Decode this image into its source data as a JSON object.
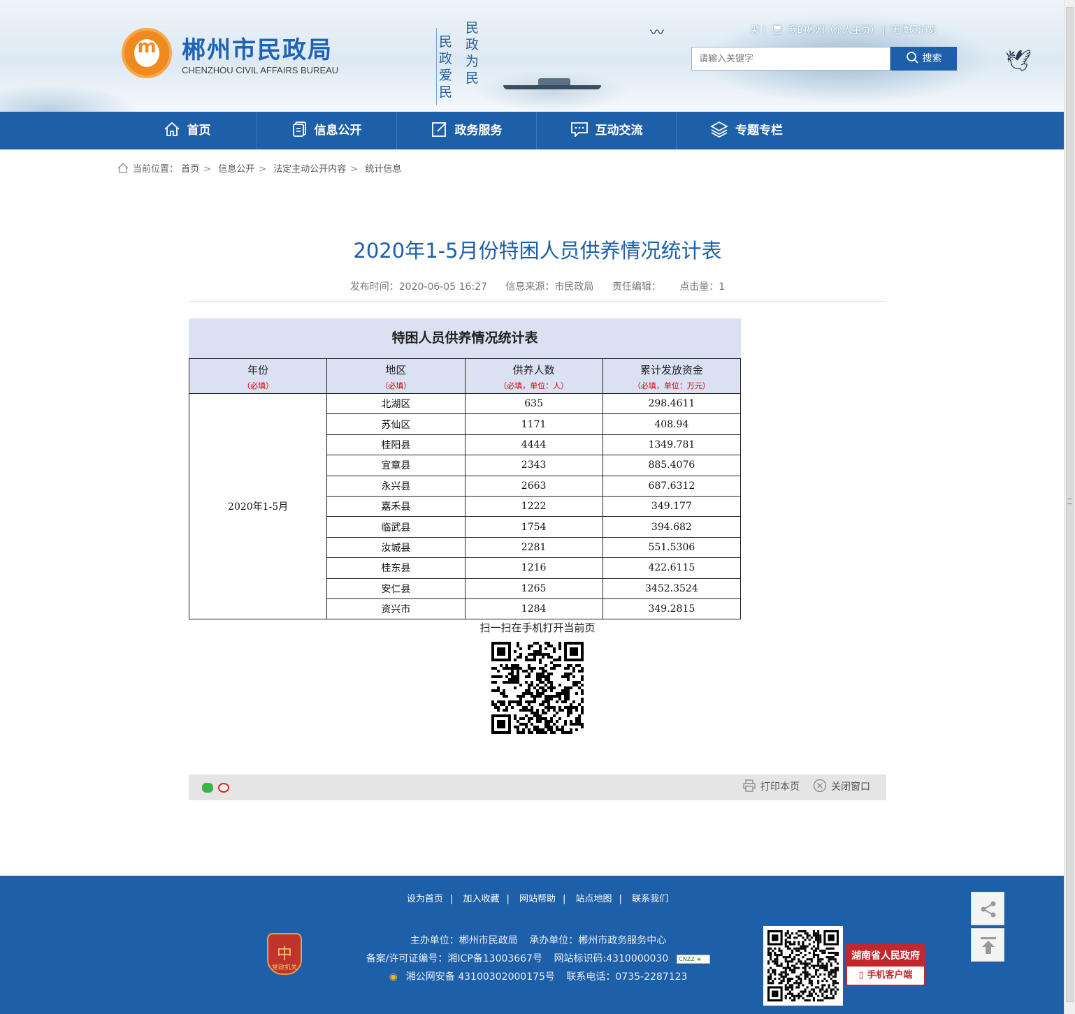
{
  "header": {
    "site_title": "郴州市民政局",
    "site_subtitle": "CHENZHOU CIVIL AFFAIRS BUREAU",
    "slogan_right": "民政为民",
    "slogan_left": "民政爱民",
    "top_links": [
      "繁",
      "我的郴州（个人主页）",
      "无障碍浏览"
    ],
    "search_placeholder": "请输入关键字",
    "search_label": "搜索"
  },
  "nav": [
    {
      "label": "首页",
      "icon": "home-icon"
    },
    {
      "label": "信息公开",
      "icon": "document-icon"
    },
    {
      "label": "政务服务",
      "icon": "edit-icon"
    },
    {
      "label": "互动交流",
      "icon": "chat-icon"
    },
    {
      "label": "专题专栏",
      "icon": "layers-icon"
    }
  ],
  "breadcrumb": {
    "prefix": "当前位置：",
    "items": [
      "首页",
      "信息公开",
      "法定主动公开内容",
      "统计信息"
    ]
  },
  "article": {
    "title": "2020年1-5月份特困人员供养情况统计表",
    "publish_time": "发布时间：2020-06-05 16:27",
    "source": "信息来源：市民政局",
    "editor": "责任编辑：",
    "clicks": "点击量：1"
  },
  "table": {
    "caption": "特困人员供养情况统计表",
    "columns": [
      {
        "label": "年份",
        "note": "（必填）"
      },
      {
        "label": "地区",
        "note": "（必填）"
      },
      {
        "label": "供养人数",
        "note": "（必填，单位：人）"
      },
      {
        "label": "累计发放资金",
        "note": "（必填，单位：万元）"
      }
    ],
    "period": "2020年1-5月",
    "rows": [
      {
        "region": "北湖区",
        "people": "635",
        "funds": "298.4611"
      },
      {
        "region": "苏仙区",
        "people": "1171",
        "funds": "408.94"
      },
      {
        "region": "桂阳县",
        "people": "4444",
        "funds": "1349.781"
      },
      {
        "region": "宜章县",
        "people": "2343",
        "funds": "885.4076"
      },
      {
        "region": "永兴县",
        "people": "2663",
        "funds": "687.6312"
      },
      {
        "region": "嘉禾县",
        "people": "1222",
        "funds": "349.177"
      },
      {
        "region": "临武县",
        "people": "1754",
        "funds": "394.682"
      },
      {
        "region": "汝城县",
        "people": "2281",
        "funds": "551.5306"
      },
      {
        "region": "桂东县",
        "people": "1216",
        "funds": "422.6115"
      },
      {
        "region": "安仁县",
        "people": "1265",
        "funds": "3452.3524"
      },
      {
        "region": "资兴市",
        "people": "1284",
        "funds": "349.2815"
      }
    ]
  },
  "qr_caption": "扫一扫在手机打开当前页",
  "share_bar": {
    "print_label": "打印本页",
    "close_label": "关闭窗口"
  },
  "footer": {
    "links": [
      "设为首页",
      "加入收藏",
      "网站帮助",
      "站点地图",
      "联系我们"
    ],
    "sponsor": "主办单位：郴州市民政局",
    "organizer": "承办单位：郴州市政务服务中心",
    "icp": "备案/许可证编号：湘ICP备13003667号",
    "site_id": "网站标识码:4310000030",
    "police": "湘公网安备 43100302000175号",
    "phone": "联系电话：0735-2287123",
    "dangzheng_label": "党政机关",
    "hn_gov": "湖南省人民政府",
    "hn_client": "手机客户端"
  },
  "colors": {
    "primary_blue": "#1d5fa9",
    "logo_orange": "#f08a1e",
    "required_red": "#dd0000",
    "table_header": "#d9e1f3"
  }
}
